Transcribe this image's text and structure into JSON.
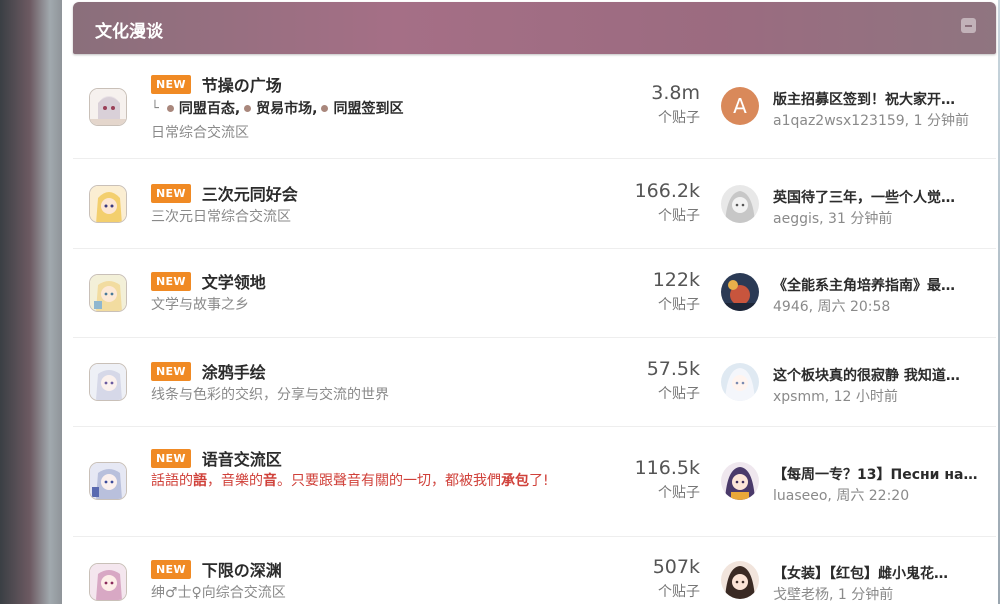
{
  "category": {
    "title": "文化漫谈"
  },
  "forums": [
    {
      "badge": "NEW",
      "name": "节操の广场",
      "subforums": [
        "同盟百态,",
        "贸易市场,",
        "同盟签到区"
      ],
      "subforum_prefix": "└",
      "description": "日常综合交流区",
      "count": "3.8m",
      "count_label": "个贴子",
      "last_post": {
        "title": "版主招募区签到！祝大家开…",
        "meta": "a1qaz2wsx123159, 1 分钟前",
        "avatar_letter": "A"
      }
    },
    {
      "badge": "NEW",
      "name": "三次元同好会",
      "description": "三次元日常综合交流区",
      "count": "166.2k",
      "count_label": "个贴子",
      "last_post": {
        "title": "英国待了三年，一些个人觉…",
        "meta": "aeggis, 31 分钟前"
      }
    },
    {
      "badge": "NEW",
      "name": "文学领地",
      "description": "文学与故事之乡",
      "count": "122k",
      "count_label": "个贴子",
      "last_post": {
        "title": "《全能系主角培养指南》最…",
        "meta": "4946, 周六 20:58"
      }
    },
    {
      "badge": "NEW",
      "name": "涂鸦手绘",
      "description": "线条与色彩的交织，分享与交流的世界",
      "count": "57.5k",
      "count_label": "个贴子",
      "last_post": {
        "title": "这个板块真的很寂静 我知道…",
        "meta": "xpsmm, 12 小时前"
      }
    },
    {
      "badge": "NEW",
      "name": "语音交流区",
      "description_parts": [
        "話語的",
        "語",
        "，音樂的",
        "音",
        "。只要跟聲音有關的一切，都被我們",
        "承包",
        "了!"
      ],
      "count": "116.5k",
      "count_label": "个贴子",
      "last_post": {
        "title": "【每周一专？13】Песни на…",
        "meta": "luaseeo, 周六 22:20"
      }
    },
    {
      "badge": "NEW",
      "name": "下限の深渊",
      "description": "绅♂士♀向综合交流区",
      "count": "507k",
      "count_label": "个贴子",
      "last_post": {
        "title": "【女装】【红包】雌小鬼花…",
        "meta": "戈壁老杨, 1 分钟前"
      }
    }
  ],
  "colors": {
    "badge": "#f08a24",
    "header": "#a56f86",
    "red_text": "#d0413a"
  },
  "icons": [
    "collapse-icon",
    "forum-icon",
    "user-avatar"
  ]
}
